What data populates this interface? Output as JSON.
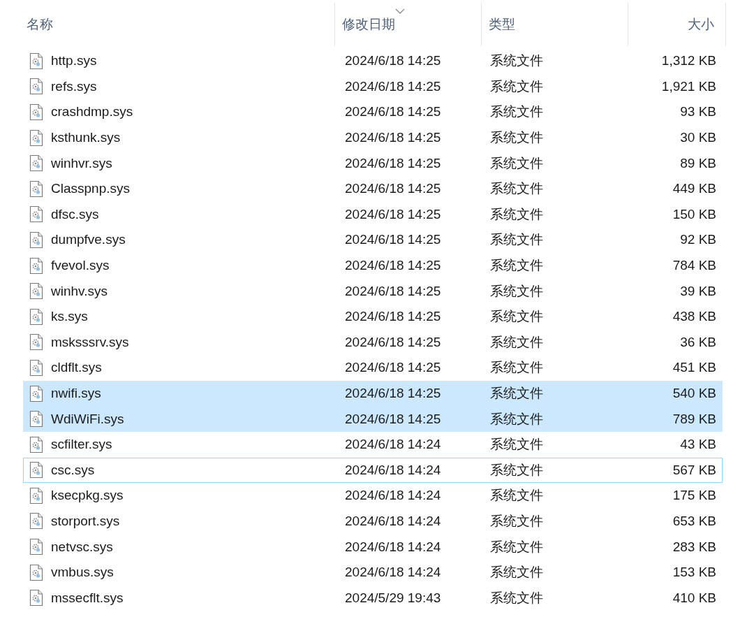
{
  "columns": [
    {
      "label": "名称",
      "sorted": false
    },
    {
      "label": "修改日期",
      "sorted": true
    },
    {
      "label": "类型",
      "sorted": false
    },
    {
      "label": "大小",
      "sorted": false
    }
  ],
  "rows": [
    {
      "name": "http.sys",
      "modified": "2024/6/18 14:25",
      "type": "系统文件",
      "size": "1,312 KB",
      "selected": false,
      "focused": false
    },
    {
      "name": "refs.sys",
      "modified": "2024/6/18 14:25",
      "type": "系统文件",
      "size": "1,921 KB",
      "selected": false,
      "focused": false
    },
    {
      "name": "crashdmp.sys",
      "modified": "2024/6/18 14:25",
      "type": "系统文件",
      "size": "93 KB",
      "selected": false,
      "focused": false
    },
    {
      "name": "ksthunk.sys",
      "modified": "2024/6/18 14:25",
      "type": "系统文件",
      "size": "30 KB",
      "selected": false,
      "focused": false
    },
    {
      "name": "winhvr.sys",
      "modified": "2024/6/18 14:25",
      "type": "系统文件",
      "size": "89 KB",
      "selected": false,
      "focused": false
    },
    {
      "name": "Classpnp.sys",
      "modified": "2024/6/18 14:25",
      "type": "系统文件",
      "size": "449 KB",
      "selected": false,
      "focused": false
    },
    {
      "name": "dfsc.sys",
      "modified": "2024/6/18 14:25",
      "type": "系统文件",
      "size": "150 KB",
      "selected": false,
      "focused": false
    },
    {
      "name": "dumpfve.sys",
      "modified": "2024/6/18 14:25",
      "type": "系统文件",
      "size": "92 KB",
      "selected": false,
      "focused": false
    },
    {
      "name": "fvevol.sys",
      "modified": "2024/6/18 14:25",
      "type": "系统文件",
      "size": "784 KB",
      "selected": false,
      "focused": false
    },
    {
      "name": "winhv.sys",
      "modified": "2024/6/18 14:25",
      "type": "系统文件",
      "size": "39 KB",
      "selected": false,
      "focused": false
    },
    {
      "name": "ks.sys",
      "modified": "2024/6/18 14:25",
      "type": "系统文件",
      "size": "438 KB",
      "selected": false,
      "focused": false
    },
    {
      "name": "msksssrv.sys",
      "modified": "2024/6/18 14:25",
      "type": "系统文件",
      "size": "36 KB",
      "selected": false,
      "focused": false
    },
    {
      "name": "cldflt.sys",
      "modified": "2024/6/18 14:25",
      "type": "系统文件",
      "size": "451 KB",
      "selected": false,
      "focused": false
    },
    {
      "name": "nwifi.sys",
      "modified": "2024/6/18 14:25",
      "type": "系统文件",
      "size": "540 KB",
      "selected": true,
      "focused": false
    },
    {
      "name": "WdiWiFi.sys",
      "modified": "2024/6/18 14:25",
      "type": "系统文件",
      "size": "789 KB",
      "selected": true,
      "focused": false
    },
    {
      "name": "scfilter.sys",
      "modified": "2024/6/18 14:24",
      "type": "系统文件",
      "size": "43 KB",
      "selected": false,
      "focused": false
    },
    {
      "name": "csc.sys",
      "modified": "2024/6/18 14:24",
      "type": "系统文件",
      "size": "567 KB",
      "selected": false,
      "focused": true
    },
    {
      "name": "ksecpkg.sys",
      "modified": "2024/6/18 14:24",
      "type": "系统文件",
      "size": "175 KB",
      "selected": false,
      "focused": false
    },
    {
      "name": "storport.sys",
      "modified": "2024/6/18 14:24",
      "type": "系统文件",
      "size": "653 KB",
      "selected": false,
      "focused": false
    },
    {
      "name": "netvsc.sys",
      "modified": "2024/6/18 14:24",
      "type": "系统文件",
      "size": "283 KB",
      "selected": false,
      "focused": false
    },
    {
      "name": "vmbus.sys",
      "modified": "2024/6/18 14:24",
      "type": "系统文件",
      "size": "153 KB",
      "selected": false,
      "focused": false
    },
    {
      "name": "mssecflt.sys",
      "modified": "2024/5/29 19:43",
      "type": "系统文件",
      "size": "410 KB",
      "selected": false,
      "focused": false
    }
  ]
}
